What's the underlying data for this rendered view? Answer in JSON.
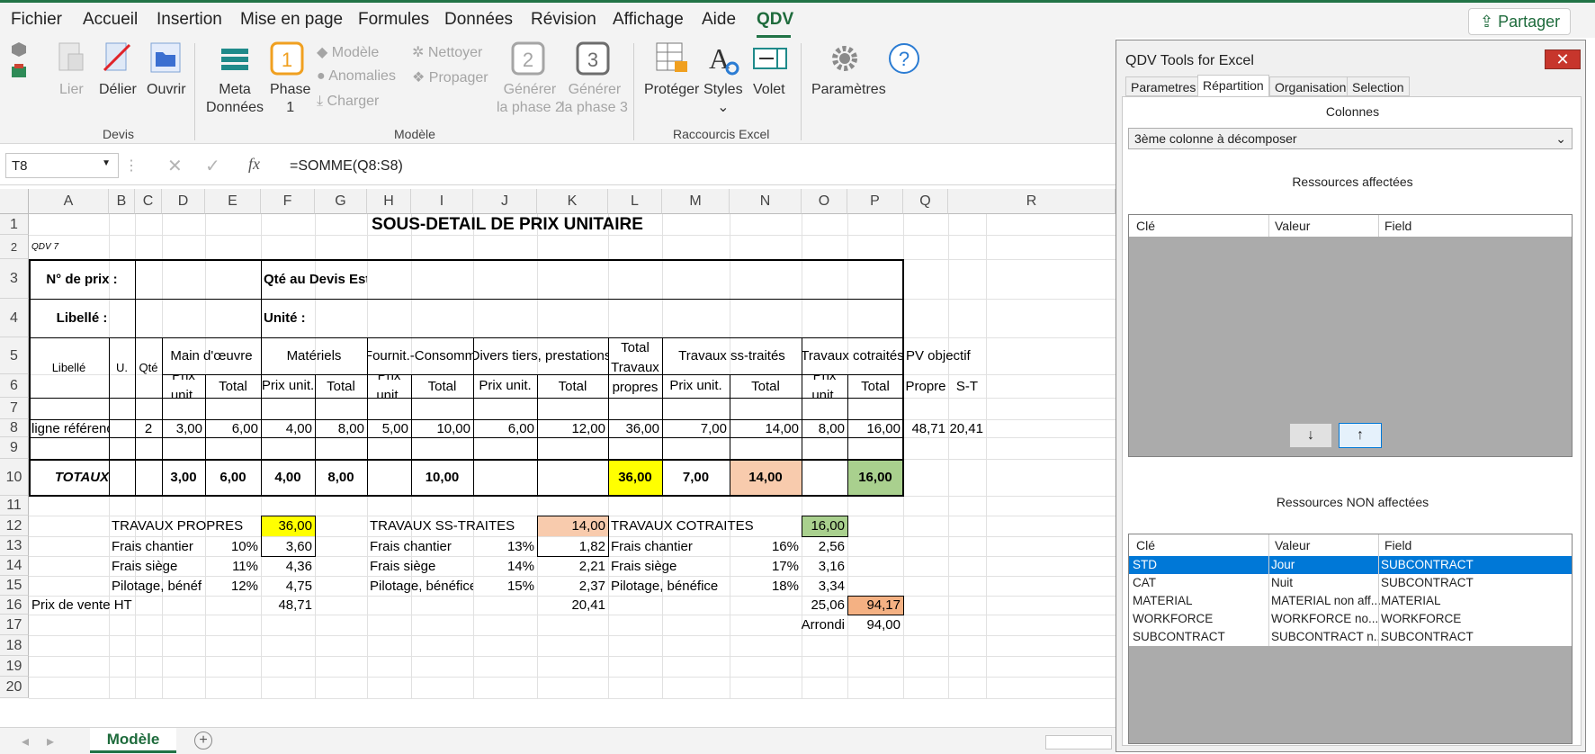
{
  "menu": {
    "items": [
      "Fichier",
      "Accueil",
      "Insertion",
      "Mise en page",
      "Formules",
      "Données",
      "Révision",
      "Affichage",
      "Aide",
      "QDV"
    ],
    "share": "Partager"
  },
  "ribbon": {
    "devis": {
      "lier": "Lier",
      "delier": "Délier",
      "ouvrir": "Ouvrir",
      "label": "Devis"
    },
    "modele": {
      "meta": [
        "Meta",
        "Données"
      ],
      "phase": [
        "Phase",
        "1"
      ],
      "modele_btn": "Modèle",
      "anomalies": "Anomalies",
      "charger": "Charger",
      "nettoyer": "Nettoyer",
      "propager": "Propager",
      "gen2": [
        "Générer",
        "la phase 2"
      ],
      "gen3": [
        "Générer",
        "la phase 3"
      ],
      "label": "Modèle"
    },
    "raccourcis": {
      "proteger": "Protéger",
      "styles": "Styles",
      "volet": "Volet",
      "label": "Raccourcis Excel"
    },
    "parametres": "Paramètres"
  },
  "formula_bar": {
    "name_box": "T8",
    "formula": "=SOMME(Q8:S8)"
  },
  "sheet": {
    "columns": [
      "A",
      "B",
      "C",
      "D",
      "E",
      "F",
      "G",
      "H",
      "I",
      "J",
      "K",
      "L",
      "M",
      "N",
      "O",
      "P",
      "Q",
      "R"
    ],
    "rows": [
      "1",
      "2",
      "3",
      "4",
      "5",
      "6",
      "7",
      "8",
      "9",
      "10",
      "11",
      "12",
      "13",
      "14",
      "15",
      "16",
      "17",
      "18",
      "19",
      "20"
    ],
    "title": "SOUS-DETAIL DE PRIX UNITAIRE",
    "qdv": "QDV 7",
    "n_prix": "N° de prix :",
    "qte_devis": "Qté au Devis Est:",
    "libelle_lbl": "Libellé :",
    "unite_lbl": "Unité :",
    "headers": {
      "libelle": "Libellé",
      "u": "U.",
      "qte": "Qté",
      "main": "Main d'œuvre",
      "materiels": "Matériels",
      "fournit": "Fournit.-Consomm",
      "divers": "Divers tiers, prestations",
      "total_tp": "Total Travaux propres",
      "ss_traites": "Travaux ss-traités",
      "cotraites": "Travaux cotraités",
      "pv": "PV objectif",
      "prix_unit": "Prix unit.",
      "total": "Total",
      "propre": "Propre",
      "st": "S-T"
    },
    "row8": {
      "libelle": "ligne référence",
      "qte": "2",
      "d": "3,00",
      "e": "6,00",
      "f": "4,00",
      "g": "8,00",
      "h": "5,00",
      "i": "10,00",
      "j": "6,00",
      "k": "12,00",
      "l": "36,00",
      "m": "7,00",
      "n": "14,00",
      "o": "8,00",
      "p": "16,00",
      "q": "48,71",
      "r": "20,41"
    },
    "totaux": {
      "label": "TOTAUX",
      "d": "3,00",
      "e": "6,00",
      "f": "4,00",
      "g": "8,00",
      "i": "10,00",
      "l": "36,00",
      "m": "7,00",
      "n": "14,00",
      "p": "16,00"
    },
    "recap": {
      "tp": {
        "label": "TRAVAUX PROPRES",
        "value": "36,00",
        "fc": "Frais chantier",
        "fc_pct": "10%",
        "fc_val": "3,60",
        "fs": "Frais siège",
        "fs_pct": "11%",
        "fs_val": "4,36",
        "pb": "Pilotage, bénéf",
        "pb_pct": "12%",
        "pb_val": "4,75"
      },
      "st": {
        "label": "TRAVAUX SS-TRAITES",
        "value": "14,00",
        "fc": "Frais chantier",
        "fc_pct": "13%",
        "fc_val": "1,82",
        "fs": "Frais siège",
        "fs_pct": "14%",
        "fs_val": "2,21",
        "pb": "Pilotage, bénéfice",
        "pb_pct": "15%",
        "pb_val": "2,37"
      },
      "ct": {
        "label": "TRAVAUX COTRAITES",
        "value": "16,00",
        "fc": "Frais chantier",
        "fc_pct": "16%",
        "fc_val": "2,56",
        "fs": "Frais siège",
        "fs_pct": "17%",
        "fs_val": "3,16",
        "pb": "Pilotage, bénéfice",
        "pb_pct": "18%",
        "pb_val": "3,34"
      },
      "pv_label": "Prix de vente HT",
      "pv_tp": "48,71",
      "pv_st": "20,41",
      "pv_ct": "25,06",
      "pv_total": "94,17",
      "arrondi": "Arrondi",
      "arrondi_val": "94,00"
    },
    "tab": "Modèle"
  },
  "panel": {
    "title": "QDV Tools for Excel",
    "tabs": [
      "Parametres",
      "Répartition",
      "Organisation",
      "Selection"
    ],
    "colonnes": "Colonnes",
    "combo": "3ème colonne à décomposer",
    "affectees": "Ressources affectées",
    "non_affectees": "Ressources NON affectées",
    "cols": [
      "Clé",
      "Valeur",
      "Field"
    ],
    "down": "↓",
    "up": "↑",
    "rows": [
      [
        "STD",
        "Jour",
        "SUBCONTRACT"
      ],
      [
        "CAT",
        "Nuit",
        "SUBCONTRACT"
      ],
      [
        "MATERIAL",
        "MATERIAL non aff...",
        "MATERIAL"
      ],
      [
        "WORKFORCE",
        "WORKFORCE no...",
        "WORKFORCE"
      ],
      [
        "SUBCONTRACT",
        "SUBCONTRACT n...",
        "SUBCONTRACT"
      ]
    ]
  },
  "colors": {
    "accent": "#217346",
    "yellow": "#ffff00",
    "salmon": "#f8cbad",
    "green": "#a9d08e",
    "orange": "#f4b183",
    "selection": "#0078d7"
  }
}
